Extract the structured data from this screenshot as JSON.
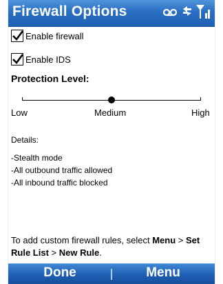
{
  "window": {
    "title": "Firewall Options"
  },
  "status_bar": {
    "icons": [
      "voicemail-icon",
      "connectivity-icon",
      "signal-strength-icon"
    ]
  },
  "options": {
    "enable_firewall": {
      "label": "Enable firewall",
      "checked": true
    },
    "enable_ids": {
      "label": "Enable IDS",
      "checked": true
    }
  },
  "protection": {
    "label": "Protection Level:",
    "levels": [
      "Low",
      "Medium",
      "High"
    ],
    "selected": "Medium"
  },
  "details": {
    "label": "Details:",
    "lines": [
      "-Stealth mode",
      "-All outbound traffic allowed",
      "-All inbound traffic blocked"
    ]
  },
  "hint": {
    "prefix": "To add custom firewall rules, select ",
    "menu": "Menu",
    "sep1": " > ",
    "set_rule_list": "Set Rule List",
    "sep2": " > ",
    "new_rule": "New Rule",
    "suffix": "."
  },
  "softkeys": {
    "left": "Done",
    "right": "Menu"
  },
  "colors": {
    "titlebar": "#2a6fc3",
    "softbar": "#1f5fb3",
    "text": "#000000"
  }
}
